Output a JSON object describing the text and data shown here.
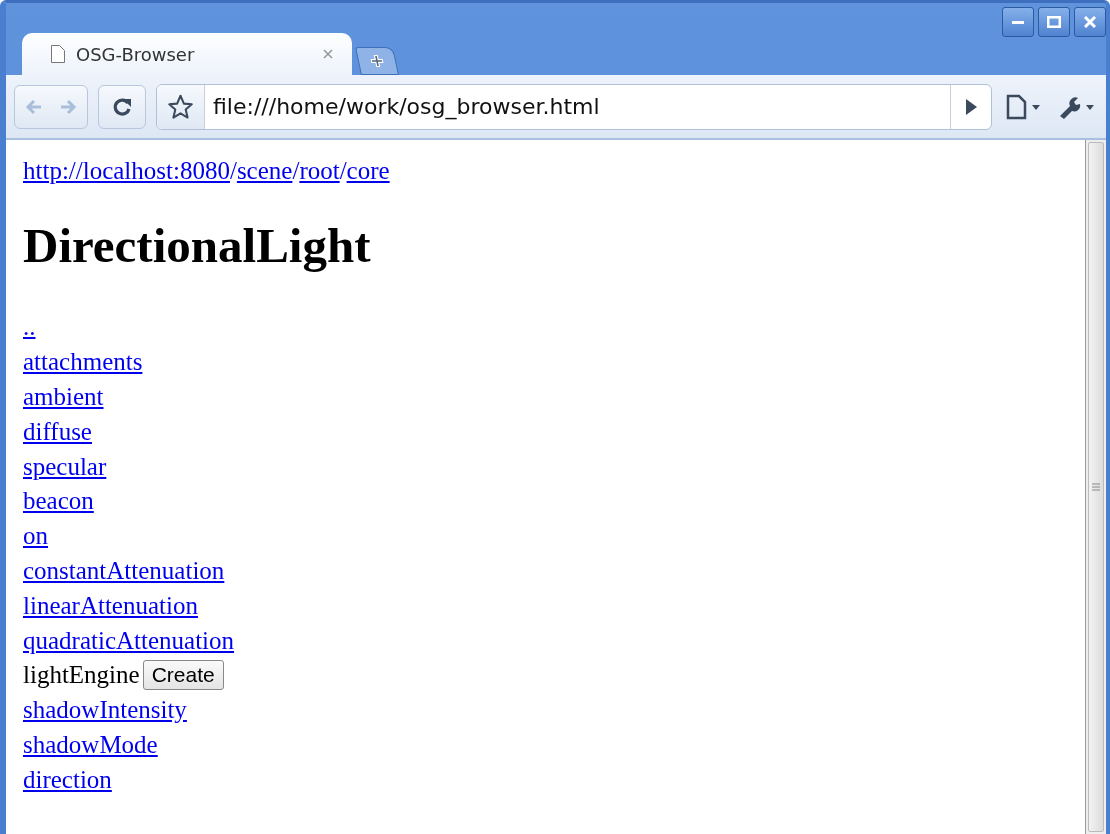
{
  "window": {
    "controls": [
      {
        "kind": "minimize"
      },
      {
        "kind": "maximize"
      },
      {
        "kind": "close"
      }
    ]
  },
  "tabs": [
    {
      "title": "OSG-Browser",
      "selected": true
    }
  ],
  "toolbar": {
    "address": "file:///home/work/osg_browser.html"
  },
  "page": {
    "breadcrumb": [
      {
        "kind": "link",
        "text": "http://localhost:8080"
      },
      {
        "kind": "separator",
        "text": "/"
      },
      {
        "kind": "link",
        "text": "scene"
      },
      {
        "kind": "separator",
        "text": "/"
      },
      {
        "kind": "link",
        "text": "root"
      },
      {
        "kind": "separator",
        "text": "/"
      },
      {
        "kind": "link",
        "text": "core"
      }
    ],
    "heading": "DirectionalLight",
    "items": [
      {
        "kind": "link",
        "text": ".."
      },
      {
        "kind": "link",
        "text": "attachments"
      },
      {
        "kind": "link",
        "text": "ambient"
      },
      {
        "kind": "link",
        "text": "diffuse"
      },
      {
        "kind": "link",
        "text": "specular"
      },
      {
        "kind": "link",
        "text": "beacon"
      },
      {
        "kind": "link",
        "text": "on"
      },
      {
        "kind": "link",
        "text": "constantAttenuation"
      },
      {
        "kind": "link",
        "text": "linearAttenuation"
      },
      {
        "kind": "link",
        "text": "quadraticAttenuation"
      },
      {
        "kind": "action",
        "text": "lightEngine",
        "button": "Create"
      },
      {
        "kind": "link",
        "text": "shadowIntensity"
      },
      {
        "kind": "link",
        "text": "shadowMode"
      },
      {
        "kind": "link",
        "text": "direction"
      }
    ]
  }
}
